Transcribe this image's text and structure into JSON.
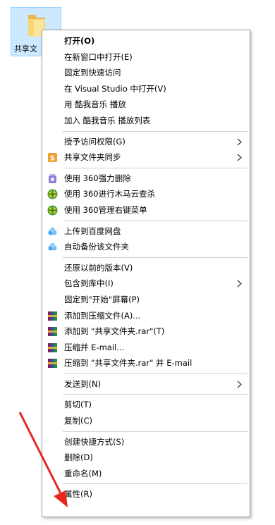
{
  "desktop": {
    "folder_label": "共享文",
    "highlight_color": "#cce8ff"
  },
  "menu": {
    "items": [
      {
        "label": "打开(O)",
        "bold": true
      },
      {
        "label": "在新窗口中打开(E)"
      },
      {
        "label": "固定到快速访问"
      },
      {
        "label": "在 Visual Studio 中打开(V)"
      },
      {
        "label": "用 酷我音乐 播放"
      },
      {
        "label": "加入 酷我音乐 播放列表"
      },
      {
        "label": "授予访问权限(G)",
        "submenu": true
      },
      {
        "label": "共享文件夹同步",
        "submenu": true,
        "icon": "sync-s-icon"
      },
      {
        "label": "使用 360强力删除",
        "icon": "360-delete-icon"
      },
      {
        "label": "使用 360进行木马云查杀",
        "icon": "360-scan-icon"
      },
      {
        "label": "使用 360管理右键菜单",
        "icon": "360-menu-icon"
      },
      {
        "label": "上传到百度网盘",
        "icon": "baidu-cloud-icon"
      },
      {
        "label": "自动备份该文件夹",
        "icon": "baidu-backup-icon"
      },
      {
        "label": "还原以前的版本(V)"
      },
      {
        "label": "包含到库中(I)",
        "submenu": true
      },
      {
        "label": "固定到\"开始\"屏幕(P)"
      },
      {
        "label": "添加到压缩文件(A)...",
        "icon": "winrar-icon"
      },
      {
        "label": "添加到 \"共享文件夹.rar\"(T)",
        "icon": "winrar-icon"
      },
      {
        "label": "压缩并 E-mail...",
        "icon": "winrar-icon"
      },
      {
        "label": "压缩到 \"共享文件夹.rar\" 并 E-mail",
        "icon": "winrar-icon"
      },
      {
        "label": "发送到(N)",
        "submenu": true
      },
      {
        "label": "剪切(T)"
      },
      {
        "label": "复制(C)"
      },
      {
        "label": "创建快捷方式(S)"
      },
      {
        "label": "删除(D)"
      },
      {
        "label": "重命名(M)"
      },
      {
        "label": "属性(R)"
      }
    ]
  },
  "annotation_color": "#e8281e"
}
